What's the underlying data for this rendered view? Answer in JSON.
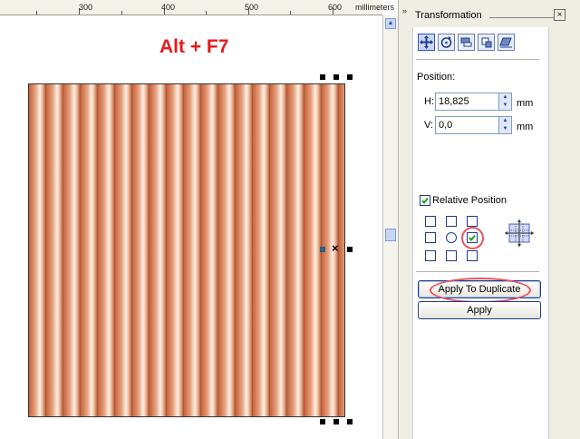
{
  "ruler": {
    "labels": [
      "300",
      "400",
      "500",
      "600"
    ],
    "unit": "millimeters"
  },
  "canvas": {
    "shortcut_text": "Alt + F7",
    "shortcut_color": "#e31b1b",
    "stripe_colors": [
      "#c5643d",
      "#fcefe6",
      "#a94d29"
    ]
  },
  "panel": {
    "title": "Transformation",
    "close_icon": "close-icon",
    "toolbar_icons": [
      "position-icon",
      "rotate-icon",
      "scale-mirror-icon",
      "size-icon",
      "skew-icon"
    ],
    "position_label": "Position:",
    "h_label": "H:",
    "h_value": "18,825",
    "h_unit": "mm",
    "v_label": "V:",
    "v_value": "0,0",
    "v_unit": "mm",
    "relative_label": "Relative Position",
    "relative_checked": true,
    "anchor_selected": "middle-right",
    "apply_duplicate_label": "Apply To Duplicate",
    "apply_label": "Apply"
  },
  "colors": {
    "annotation_red": "#e8555f",
    "accent_blue": "#1f3c88"
  }
}
